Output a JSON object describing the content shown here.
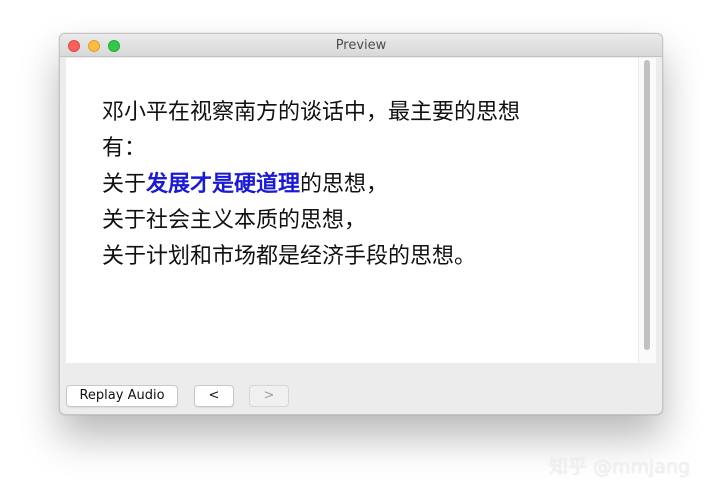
{
  "window": {
    "title": "Preview"
  },
  "card": {
    "lines": [
      {
        "parts": [
          "邓小平在视察南方的谈话中，最主要的思想"
        ]
      },
      {
        "parts": [
          "有："
        ]
      },
      {
        "prefix": "关于",
        "highlight": "发展才是硬道理",
        "suffix": "的思想，"
      },
      {
        "parts": [
          "关于社会主义本质的思想，"
        ]
      },
      {
        "parts": [
          "关于计划和市场都是经济手段的思想。"
        ]
      }
    ],
    "highlight_color": "#1a1ad6"
  },
  "controls": {
    "replay_label": "Replay Audio",
    "prev_label": "<",
    "next_label": ">"
  },
  "watermark": {
    "text": "知乎 @mmjang"
  }
}
